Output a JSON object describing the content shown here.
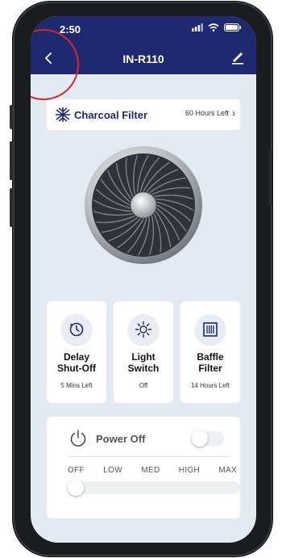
{
  "status": {
    "time": "2:50"
  },
  "header": {
    "title": "IN-R110"
  },
  "filter": {
    "name": "Charcoal Filter",
    "time_left": "60 Hours Left"
  },
  "cards": [
    {
      "title_line1": "Delay",
      "title_line2": "Shut-Off",
      "subtitle": "5 Mins Left",
      "icon": "timer-icon"
    },
    {
      "title_line1": "Light",
      "title_line2": "Switch",
      "subtitle": "Off",
      "icon": "light-icon"
    },
    {
      "title_line1": "Baffle",
      "title_line2": "Filter",
      "subtitle": "14 Hours Left",
      "icon": "baffle-filter-icon"
    }
  ],
  "power": {
    "label": "Power Off",
    "toggle_on": false
  },
  "speed": {
    "levels": [
      "OFF",
      "LOW",
      "MED",
      "HIGH",
      "MAX"
    ],
    "selected": "OFF"
  },
  "colors": {
    "navbar": "#1f2970",
    "accent": "#1f2970",
    "highlight_circle": "#d42a2a"
  }
}
